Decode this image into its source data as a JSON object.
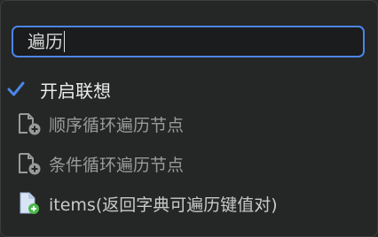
{
  "search": {
    "value": "遍历"
  },
  "option": {
    "checked": true,
    "label": "开启联想"
  },
  "results": [
    {
      "label": "顺序循环遍历节点",
      "icon": "add-node-icon"
    },
    {
      "label": "条件循环遍历节点",
      "icon": "add-node-icon"
    },
    {
      "label": "items(返回字典可遍历键值对)",
      "icon": "add-file-icon"
    }
  ],
  "colors": {
    "accent": "#4a86e8",
    "add_badge": "#4bb84b"
  }
}
